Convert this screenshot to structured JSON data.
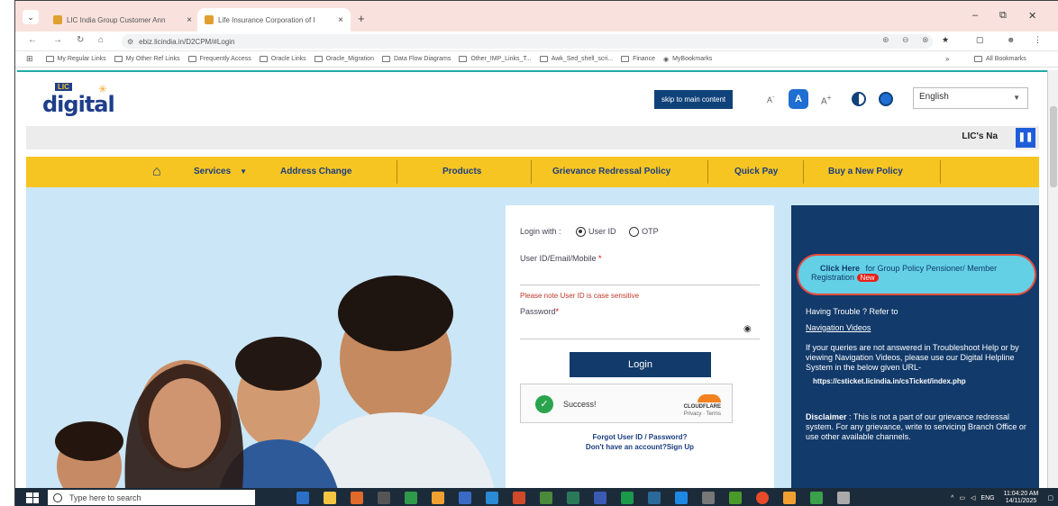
{
  "browser": {
    "tabs": [
      {
        "title": "LIC India Group Customer Ann",
        "close": "×",
        "color": "#e0a030"
      },
      {
        "title": "Life Insurance Corporation of I",
        "close": "×",
        "color": "#e0a030"
      }
    ],
    "new_tab": "+",
    "window_controls": [
      "–",
      "⧉",
      "✕"
    ],
    "url": "ebiz.licindia.in/D2CPM/#Login",
    "bookmarks": [
      "My Regular Links",
      "My Other Ref Links",
      "Frequently Access",
      "Oracle Links",
      "Oracle_Migration",
      "Data Flow Diagrams",
      "Other_IMP_Links_T...",
      "Awk_Sed_shell_scri...",
      "Finance",
      "MyBookmarks"
    ],
    "all_bookmarks": "All Bookmarks",
    "more": "»"
  },
  "header": {
    "logo_top": "LIC",
    "logo_main": "digital",
    "skip_label": "skip to main content",
    "font_small": "A",
    "font_mid": "A",
    "font_large": "A",
    "language": "English",
    "marquee": "LIC's Na"
  },
  "nav": {
    "items": [
      "Services",
      "Address Change",
      "Products",
      "Grievance Redressal Policy",
      "Quick Pay",
      "Buy a New Policy"
    ]
  },
  "login": {
    "login_with": "Login with :",
    "opt_user": "User ID",
    "opt_otp": "OTP",
    "user_label": "User ID/Email/Mobile",
    "note": "Please note User ID is case sensitive",
    "pwd_label": "Password",
    "button": "Login",
    "captcha_status": "Success!",
    "captcha_brand": "CLOUDFLARE",
    "captcha_links": "Privacy · Terms",
    "forgot": "Forgot User ID / Password?",
    "signup": "Don't have an account?Sign Up"
  },
  "side": {
    "click_here": "Click Here",
    "click_text": "for Group Policy Pensioner/ Member Registration",
    "new_badge": "New",
    "trouble": "Having Trouble ? Refer to",
    "nav_videos": "Navigation Videos",
    "queries": "If your queries are not answered in Troubleshoot Help or by viewing Navigation Videos, please use our Digital Helpline System in the below given URL-",
    "helpline_url": "https://csticket.licindia.in/csTicket/index.php",
    "disclaimer_label": "Disclaimer",
    "disclaimer": " : This is not a part of our grievance redressal system. For any grievance, write to servicing Branch Office or use other available channels."
  },
  "taskbar": {
    "search": "Type here to search",
    "lang": "ENG",
    "time": "11:04:20 AM",
    "date": "14/11/2025"
  }
}
